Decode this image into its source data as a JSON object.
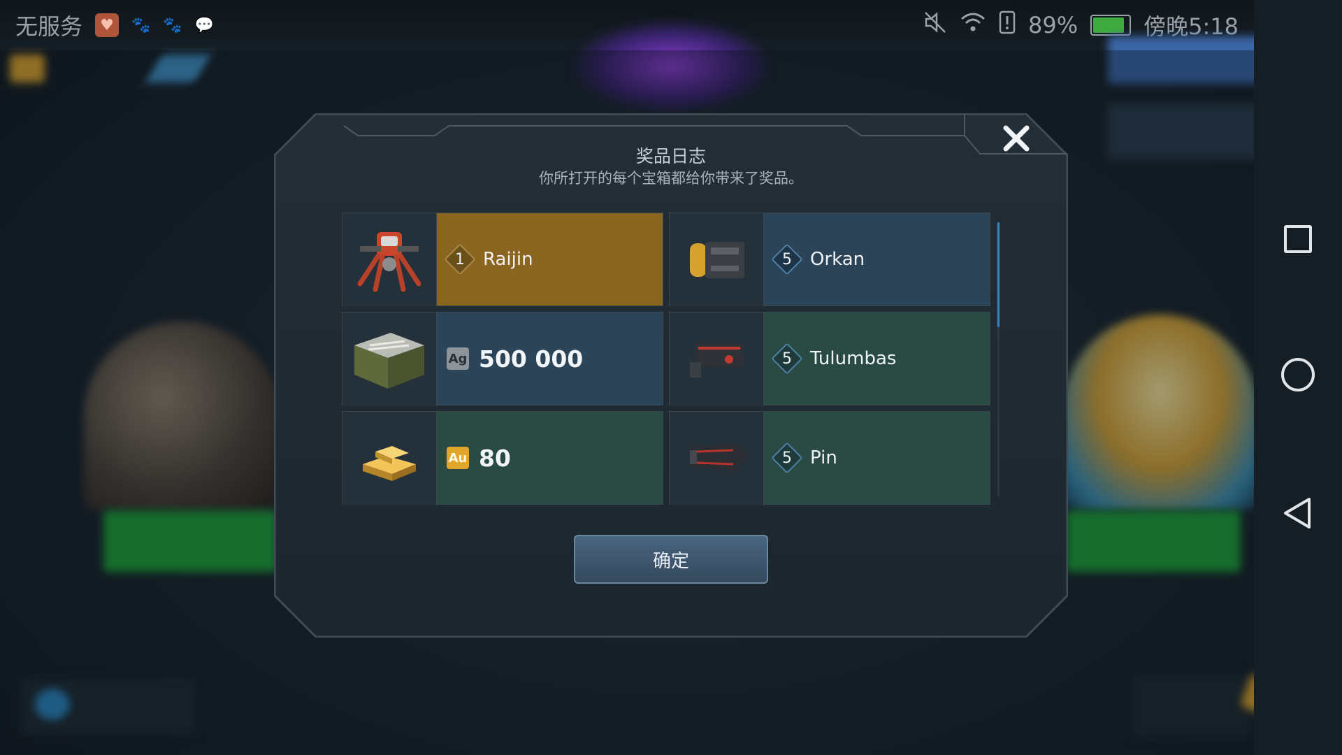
{
  "statusbar": {
    "carrier": "无服务",
    "battery_text": "89%",
    "battery_level": 0.89,
    "time": "傍晚5:18"
  },
  "dialog": {
    "title": "奖品日志",
    "subtitle": "你所打开的每个宝箱都给你带来了奖品。",
    "confirm_label": "确定",
    "close_icon": "close-icon"
  },
  "rewards": [
    {
      "kind": "robot",
      "icon": "robot-icon",
      "level": "1",
      "name": "Raijin",
      "color": "#8a6520"
    },
    {
      "kind": "weapon",
      "icon": "weapon-icon",
      "level": "5",
      "name": "Orkan",
      "color": "#2c4457"
    },
    {
      "kind": "silver",
      "icon": "silver-crate-icon",
      "currency": "Ag",
      "amount": "500 000",
      "color": "#2c4457"
    },
    {
      "kind": "weapon",
      "icon": "weapon-icon",
      "level": "5",
      "name": "Tulumbas",
      "color": "#2a4a44"
    },
    {
      "kind": "gold",
      "icon": "gold-bars-icon",
      "currency": "Au",
      "amount": "80",
      "color": "#2a4a44"
    },
    {
      "kind": "weapon",
      "icon": "weapon-icon",
      "level": "5",
      "name": "Pin",
      "color": "#2a4a44"
    }
  ],
  "colors": {
    "accent": "#3a86c8",
    "gold_cell": "#8a6520",
    "blue_cell": "#2c4457",
    "green_cell": "#2a4a44"
  }
}
